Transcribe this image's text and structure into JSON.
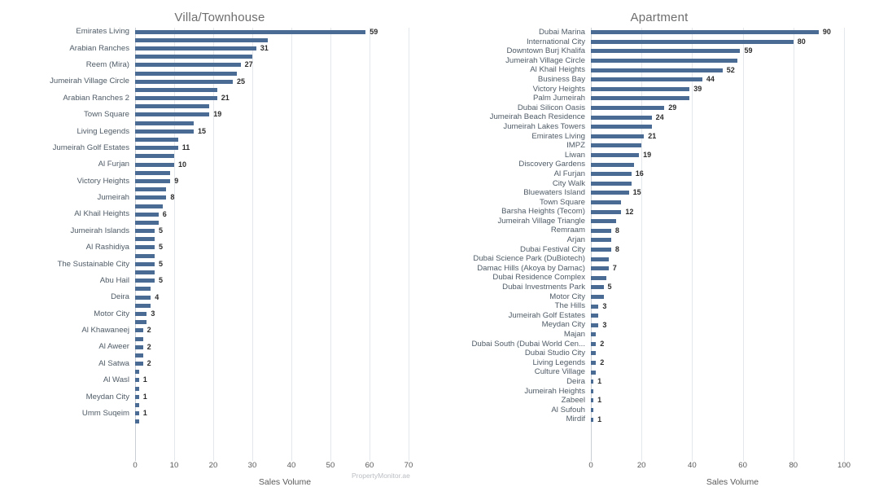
{
  "watermark": "PropertyMonitor.ae",
  "theme": {
    "bar_color": "#4a6c94",
    "grid_color": "#e4e8ec",
    "axis_color": "#c9ced4",
    "label_color": "#4f5b66",
    "title_color": "#6e6e6e",
    "background": "#ffffff"
  },
  "chart_data": [
    {
      "type": "bar",
      "orientation": "horizontal",
      "title": "Villa/Townhouse",
      "xlabel": "Sales Volume",
      "ylabel": "",
      "xlim": [
        0,
        70
      ],
      "xticks": [
        0,
        10,
        20,
        30,
        40,
        50,
        60,
        70
      ],
      "grid": true,
      "legend": "none",
      "watermark": "PropertyMonitor.ae",
      "categories": [
        "Emirates Living",
        "Arabian Ranches",
        "Reem (Mira)",
        "Jumeirah Village Circle",
        "Arabian Ranches 2",
        "Town Square",
        "Living Legends",
        "Jumeirah Golf Estates",
        "Al Furjan",
        "Victory Heights",
        "Jumeirah",
        "Al Khail Heights",
        "Jumeirah Islands",
        "Al Rashidiya",
        "The Sustainable City",
        "Abu Hail",
        "Deira",
        "Motor City",
        "Al Khawaneej",
        "Al Aweer",
        "Al Satwa",
        "Al Wasl",
        "Meydan City",
        "Umm Suqeim"
      ],
      "values": [
        59,
        31,
        27,
        25,
        21,
        19,
        15,
        11,
        10,
        9,
        8,
        6,
        5,
        5,
        5,
        5,
        4,
        3,
        2,
        2,
        2,
        1,
        1,
        1,
        1,
        1
      ],
      "bars": [
        {
          "label": "Emirates Living",
          "value": 59,
          "show_value": true
        },
        {
          "label": "",
          "value": 34,
          "show_value": false
        },
        {
          "label": "Arabian Ranches",
          "value": 31,
          "show_value": true
        },
        {
          "label": "",
          "value": 30,
          "show_value": false
        },
        {
          "label": "Reem (Mira)",
          "value": 27,
          "show_value": true
        },
        {
          "label": "",
          "value": 26,
          "show_value": false
        },
        {
          "label": "Jumeirah Village Circle",
          "value": 25,
          "show_value": true
        },
        {
          "label": "",
          "value": 21,
          "show_value": false
        },
        {
          "label": "Arabian Ranches 2",
          "value": 21,
          "show_value": true
        },
        {
          "label": "",
          "value": 19,
          "show_value": false
        },
        {
          "label": "Town Square",
          "value": 19,
          "show_value": true
        },
        {
          "label": "",
          "value": 15,
          "show_value": false
        },
        {
          "label": "Living Legends",
          "value": 15,
          "show_value": true
        },
        {
          "label": "",
          "value": 11,
          "show_value": false
        },
        {
          "label": "Jumeirah Golf Estates",
          "value": 11,
          "show_value": true
        },
        {
          "label": "",
          "value": 10,
          "show_value": false
        },
        {
          "label": "Al Furjan",
          "value": 10,
          "show_value": true
        },
        {
          "label": "",
          "value": 9,
          "show_value": false
        },
        {
          "label": "Victory Heights",
          "value": 9,
          "show_value": true
        },
        {
          "label": "",
          "value": 8,
          "show_value": false
        },
        {
          "label": "Jumeirah",
          "value": 8,
          "show_value": true
        },
        {
          "label": "",
          "value": 7,
          "show_value": false
        },
        {
          "label": "Al Khail Heights",
          "value": 6,
          "show_value": true
        },
        {
          "label": "",
          "value": 6,
          "show_value": false
        },
        {
          "label": "Jumeirah Islands",
          "value": 5,
          "show_value": true
        },
        {
          "label": "",
          "value": 5,
          "show_value": false
        },
        {
          "label": "Al Rashidiya",
          "value": 5,
          "show_value": true
        },
        {
          "label": "",
          "value": 5,
          "show_value": false
        },
        {
          "label": "The Sustainable City",
          "value": 5,
          "show_value": true
        },
        {
          "label": "",
          "value": 5,
          "show_value": false
        },
        {
          "label": "Abu Hail",
          "value": 5,
          "show_value": true
        },
        {
          "label": "",
          "value": 4,
          "show_value": false
        },
        {
          "label": "Deira",
          "value": 4,
          "show_value": true
        },
        {
          "label": "",
          "value": 4,
          "show_value": false
        },
        {
          "label": "Motor City",
          "value": 3,
          "show_value": true
        },
        {
          "label": "",
          "value": 3,
          "show_value": false
        },
        {
          "label": "Al Khawaneej",
          "value": 2,
          "show_value": true
        },
        {
          "label": "",
          "value": 2,
          "show_value": false
        },
        {
          "label": "Al Aweer",
          "value": 2,
          "show_value": true
        },
        {
          "label": "",
          "value": 2,
          "show_value": false
        },
        {
          "label": "Al Satwa",
          "value": 2,
          "show_value": true
        },
        {
          "label": "",
          "value": 1,
          "show_value": false
        },
        {
          "label": "Al Wasl",
          "value": 1,
          "show_value": true
        },
        {
          "label": "",
          "value": 1,
          "show_value": false
        },
        {
          "label": "Meydan City",
          "value": 1,
          "show_value": true
        },
        {
          "label": "",
          "value": 1,
          "show_value": false
        },
        {
          "label": "Umm Suqeim",
          "value": 1,
          "show_value": true
        },
        {
          "label": "",
          "value": 1,
          "show_value": false
        }
      ]
    },
    {
      "type": "bar",
      "orientation": "horizontal",
      "title": "Apartment",
      "xlabel": "Sales Volume",
      "ylabel": "",
      "xlim": [
        0,
        100
      ],
      "xticks": [
        0,
        20,
        40,
        60,
        80,
        100
      ],
      "grid": true,
      "legend": "none",
      "watermark": "PropertyMonitor.ae",
      "categories": [
        "Dubai Marina",
        "International City",
        "Downtown Burj Khalifa",
        "Jumeirah Village Circle",
        "Al Khail Heights",
        "Business Bay",
        "Victory Heights",
        "Palm Jumeirah",
        "Dubai Silicon Oasis",
        "Jumeirah Beach Residence",
        "Jumeirah Lakes Towers",
        "Emirates Living",
        "IMPZ",
        "Liwan",
        "Discovery Gardens",
        "Al Furjan",
        "City Walk",
        "Bluewaters Island",
        "Town Square",
        "Barsha Heights (Tecom)",
        "Jumeirah Village Triangle",
        "Remraam",
        "Arjan",
        "Dubai Festival City",
        "Dubai Science Park (DuBiotech)",
        "Damac Hills (Akoya by Damac)",
        "Dubai Residence Complex",
        "Dubai Investments Park",
        "Motor City",
        "The Hills",
        "Jumeirah Golf Estates",
        "Meydan City",
        "Majan",
        "Dubai South (Dubai World Cen...",
        "Dubai Studio City",
        "Living Legends",
        "Culture Village",
        "Deira",
        "Jumeirah Heights",
        "Zabeel",
        "Al Sufouh",
        "Mirdif"
      ],
      "values": [
        90,
        80,
        59,
        52,
        52,
        44,
        39,
        39,
        29,
        24,
        24,
        21,
        19,
        19,
        17,
        16,
        16,
        15,
        15,
        12,
        11,
        8,
        8,
        8,
        7,
        7,
        6,
        5,
        5,
        3,
        3,
        3,
        2,
        2,
        2,
        2,
        2,
        1,
        1,
        1,
        1,
        1
      ],
      "bars": [
        {
          "label": "Dubai Marina",
          "value": 90,
          "show_value": true
        },
        {
          "label": "International City",
          "value": 80,
          "show_value": true
        },
        {
          "label": "Downtown Burj Khalifa",
          "value": 59,
          "show_value": true
        },
        {
          "label": "Jumeirah Village Circle",
          "value": 58,
          "show_value": false
        },
        {
          "label": "Al Khail Heights",
          "value": 52,
          "show_value": true
        },
        {
          "label": "Business Bay",
          "value": 44,
          "show_value": true
        },
        {
          "label": "Victory Heights",
          "value": 39,
          "show_value": true
        },
        {
          "label": "Palm Jumeirah",
          "value": 39,
          "show_value": false
        },
        {
          "label": "Dubai Silicon Oasis",
          "value": 29,
          "show_value": true
        },
        {
          "label": "Jumeirah Beach Residence",
          "value": 24,
          "show_value": true
        },
        {
          "label": "Jumeirah Lakes Towers",
          "value": 24,
          "show_value": false
        },
        {
          "label": "Emirates Living",
          "value": 21,
          "show_value": true
        },
        {
          "label": "IMPZ",
          "value": 20,
          "show_value": false
        },
        {
          "label": "Liwan",
          "value": 19,
          "show_value": true
        },
        {
          "label": "Discovery Gardens",
          "value": 17,
          "show_value": false
        },
        {
          "label": "Al Furjan",
          "value": 16,
          "show_value": true
        },
        {
          "label": "City Walk",
          "value": 16,
          "show_value": false
        },
        {
          "label": "Bluewaters Island",
          "value": 15,
          "show_value": true
        },
        {
          "label": "Town Square",
          "value": 12,
          "show_value": false
        },
        {
          "label": "Barsha Heights (Tecom)",
          "value": 12,
          "show_value": true
        },
        {
          "label": "Jumeirah Village Triangle",
          "value": 10,
          "show_value": false
        },
        {
          "label": "Remraam",
          "value": 8,
          "show_value": true
        },
        {
          "label": "Arjan",
          "value": 8,
          "show_value": false
        },
        {
          "label": "Dubai Festival City",
          "value": 8,
          "show_value": true
        },
        {
          "label": "Dubai Science Park (DuBiotech)",
          "value": 7,
          "show_value": false
        },
        {
          "label": "Damac Hills (Akoya by Damac)",
          "value": 7,
          "show_value": true
        },
        {
          "label": "Dubai Residence Complex",
          "value": 6,
          "show_value": false
        },
        {
          "label": "Dubai Investments Park",
          "value": 5,
          "show_value": true
        },
        {
          "label": "Motor City",
          "value": 5,
          "show_value": false
        },
        {
          "label": "The Hills",
          "value": 3,
          "show_value": true
        },
        {
          "label": "Jumeirah Golf Estates",
          "value": 3,
          "show_value": false
        },
        {
          "label": "Meydan City",
          "value": 3,
          "show_value": true
        },
        {
          "label": "Majan",
          "value": 2,
          "show_value": false
        },
        {
          "label": "Dubai South (Dubai World Cen...",
          "value": 2,
          "show_value": true
        },
        {
          "label": "Dubai Studio City",
          "value": 2,
          "show_value": false
        },
        {
          "label": "Living Legends",
          "value": 2,
          "show_value": true
        },
        {
          "label": "Culture Village",
          "value": 2,
          "show_value": false
        },
        {
          "label": "Deira",
          "value": 1,
          "show_value": true
        },
        {
          "label": "Jumeirah Heights",
          "value": 1,
          "show_value": false
        },
        {
          "label": "Zabeel",
          "value": 1,
          "show_value": true
        },
        {
          "label": "Al Sufouh",
          "value": 1,
          "show_value": false
        },
        {
          "label": "Mirdif",
          "value": 1,
          "show_value": true
        }
      ]
    }
  ]
}
